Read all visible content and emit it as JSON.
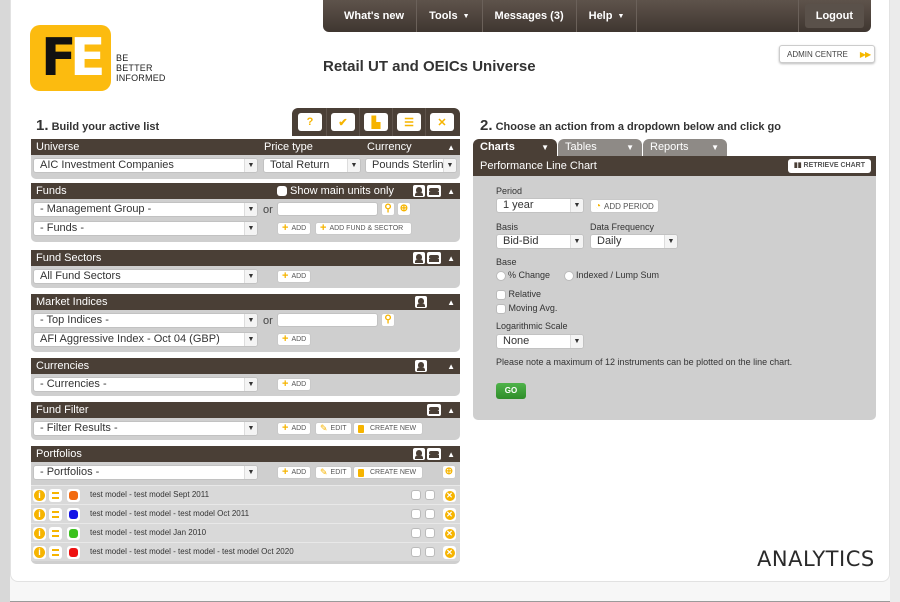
{
  "brand": {
    "logo_letters": [
      "F",
      "E"
    ],
    "tagline": [
      "BE",
      "BETTER",
      "INFORMED"
    ],
    "colors": {
      "accent": "#fcbb0f",
      "dark": "#4a3f36",
      "go": "#3a9d35"
    }
  },
  "topnav": {
    "items": [
      {
        "label": "What's new",
        "has_caret": false
      },
      {
        "label": "Tools",
        "has_caret": true
      },
      {
        "label": "Messages (3)",
        "has_caret": false
      },
      {
        "label": "Help",
        "has_caret": true
      }
    ],
    "logout": "Logout",
    "caret": "▼"
  },
  "page_title": "Retail UT and OEICs Universe",
  "admin_centre": {
    "label": "ADMIN CENTRE",
    "arrows": "▶▶"
  },
  "step1": {
    "num": "1.",
    "title": "Build your active list",
    "toolbar_icons": [
      "help-icon",
      "user-check-icon",
      "save-list-icon",
      "load-list-icon",
      "clear-list-icon"
    ],
    "universe": {
      "labels": {
        "universe": "Universe",
        "price_type": "Price type",
        "currency": "Currency"
      },
      "universe_value": "AIC Investment Companies",
      "price_type_value": "Total Return",
      "currency_value": "Pounds Sterling"
    },
    "funds": {
      "title": "Funds",
      "show_main_units": "Show main units only",
      "management_group": "- Management Group -",
      "funds": "- Funds -",
      "or": "or",
      "add": "ADD",
      "add_fund_sector": "ADD FUND & SECTOR"
    },
    "fund_sectors": {
      "title": "Fund Sectors",
      "value": "All Fund Sectors",
      "add": "ADD"
    },
    "market_indices": {
      "title": "Market Indices",
      "top_indices": "- Top Indices -",
      "index_value": "AFI Aggressive Index - Oct 04 (GBP)",
      "or": "or",
      "add": "ADD"
    },
    "currencies": {
      "title": "Currencies",
      "value": "- Currencies -",
      "add": "ADD"
    },
    "fund_filter": {
      "title": "Fund Filter",
      "value": "- Filter Results -",
      "add": "ADD",
      "edit": "EDIT",
      "create_new": "CREATE NEW"
    },
    "portfolios": {
      "title": "Portfolios",
      "value": "- Portfolios -",
      "add": "ADD",
      "edit": "EDIT",
      "create_new": "CREATE NEW",
      "items": [
        {
          "name": "test model - test model Sept 2011",
          "color": "#f26a10"
        },
        {
          "name": "test model - test model - test model Oct 2011",
          "color": "#1414e6"
        },
        {
          "name": "test model - test model Jan 2010",
          "color": "#3cc21e"
        },
        {
          "name": "test model - test model - test model - test model Oct 2020",
          "color": "#ee1111"
        }
      ]
    }
  },
  "step2": {
    "num": "2.",
    "title": "Choose an action from a dropdown below and click go",
    "tabs": [
      {
        "label": "Charts",
        "active": true
      },
      {
        "label": "Tables",
        "active": false
      },
      {
        "label": "Reports",
        "active": false
      }
    ],
    "panel_title": "Performance Line Chart",
    "retrieve_chart": "RETRIEVE CHART",
    "period_label": "Period",
    "period_value": "1 year",
    "add_period": "ADD PERIOD",
    "basis_label": "Basis",
    "basis_value": "Bid-Bid",
    "frequency_label": "Data Frequency",
    "frequency_value": "Daily",
    "base_label": "Base",
    "base_options": [
      "% Change",
      "Indexed / Lump Sum"
    ],
    "relative": "Relative",
    "moving_avg": "Moving Avg.",
    "log_scale_label": "Logarithmic Scale",
    "log_scale_value": "None",
    "note": "Please note a maximum of 12 instruments can be plotted on the line chart.",
    "go": "GO"
  },
  "footer_brand": "ANALYTICS"
}
